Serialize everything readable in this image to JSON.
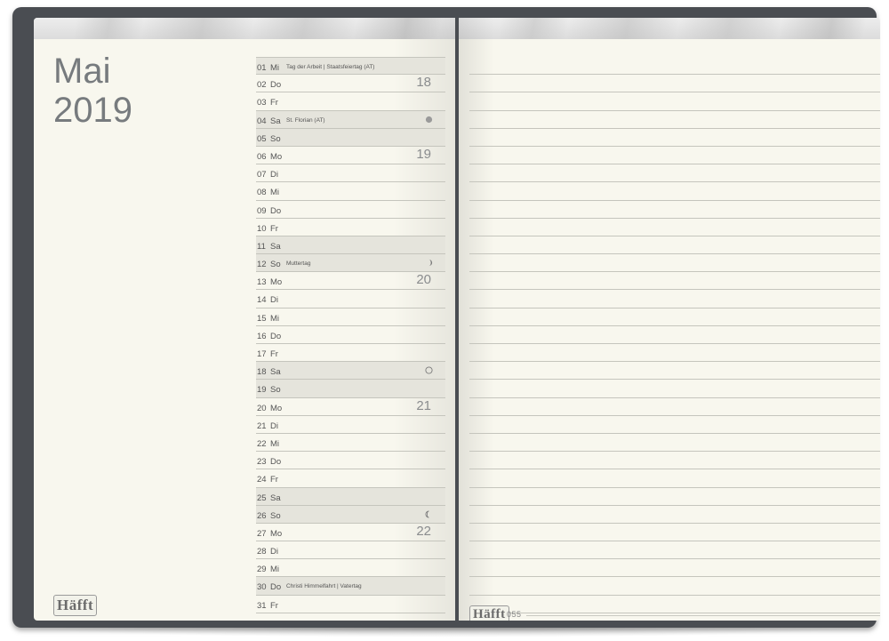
{
  "left_page": {
    "month": "Mai",
    "year": "2019",
    "logo": "Häfft"
  },
  "right_page": {
    "logo": "Häfft",
    "page_number": "055",
    "ruled_line_count": 31
  },
  "days": [
    {
      "num": "01",
      "name": "Mi",
      "note": "Tag der Arbeit | Staatsfeiertag (AT)",
      "shade": true
    },
    {
      "num": "02",
      "name": "Do",
      "week": "18"
    },
    {
      "num": "03",
      "name": "Fr"
    },
    {
      "num": "04",
      "name": "Sa",
      "note": "St. Florian (AT)",
      "shade": true,
      "moon": "new"
    },
    {
      "num": "05",
      "name": "So",
      "shade": true
    },
    {
      "num": "06",
      "name": "Mo",
      "week": "19"
    },
    {
      "num": "07",
      "name": "Di"
    },
    {
      "num": "08",
      "name": "Mi"
    },
    {
      "num": "09",
      "name": "Do"
    },
    {
      "num": "10",
      "name": "Fr"
    },
    {
      "num": "11",
      "name": "Sa",
      "shade": true
    },
    {
      "num": "12",
      "name": "So",
      "note": "Muttertag",
      "shade": true,
      "moon": "first-quarter"
    },
    {
      "num": "13",
      "name": "Mo",
      "week": "20"
    },
    {
      "num": "14",
      "name": "Di"
    },
    {
      "num": "15",
      "name": "Mi"
    },
    {
      "num": "16",
      "name": "Do"
    },
    {
      "num": "17",
      "name": "Fr"
    },
    {
      "num": "18",
      "name": "Sa",
      "shade": true,
      "moon": "full"
    },
    {
      "num": "19",
      "name": "So",
      "shade": true
    },
    {
      "num": "20",
      "name": "Mo",
      "week": "21"
    },
    {
      "num": "21",
      "name": "Di"
    },
    {
      "num": "22",
      "name": "Mi"
    },
    {
      "num": "23",
      "name": "Do"
    },
    {
      "num": "24",
      "name": "Fr"
    },
    {
      "num": "25",
      "name": "Sa",
      "shade": true
    },
    {
      "num": "26",
      "name": "So",
      "shade": true,
      "moon": "last-quarter"
    },
    {
      "num": "27",
      "name": "Mo",
      "week": "22"
    },
    {
      "num": "28",
      "name": "Di"
    },
    {
      "num": "29",
      "name": "Mi"
    },
    {
      "num": "30",
      "name": "Do",
      "note": "Christi Himmelfahrt | Vatertag",
      "shade": true
    },
    {
      "num": "31",
      "name": "Fr"
    }
  ],
  "colors": {
    "paper": "#f8f7ee",
    "cover": "#4a4d52",
    "weekend_shade": "#e5e4dc",
    "rule_line": "#c5c5bd",
    "title_gray": "#777b7e"
  }
}
